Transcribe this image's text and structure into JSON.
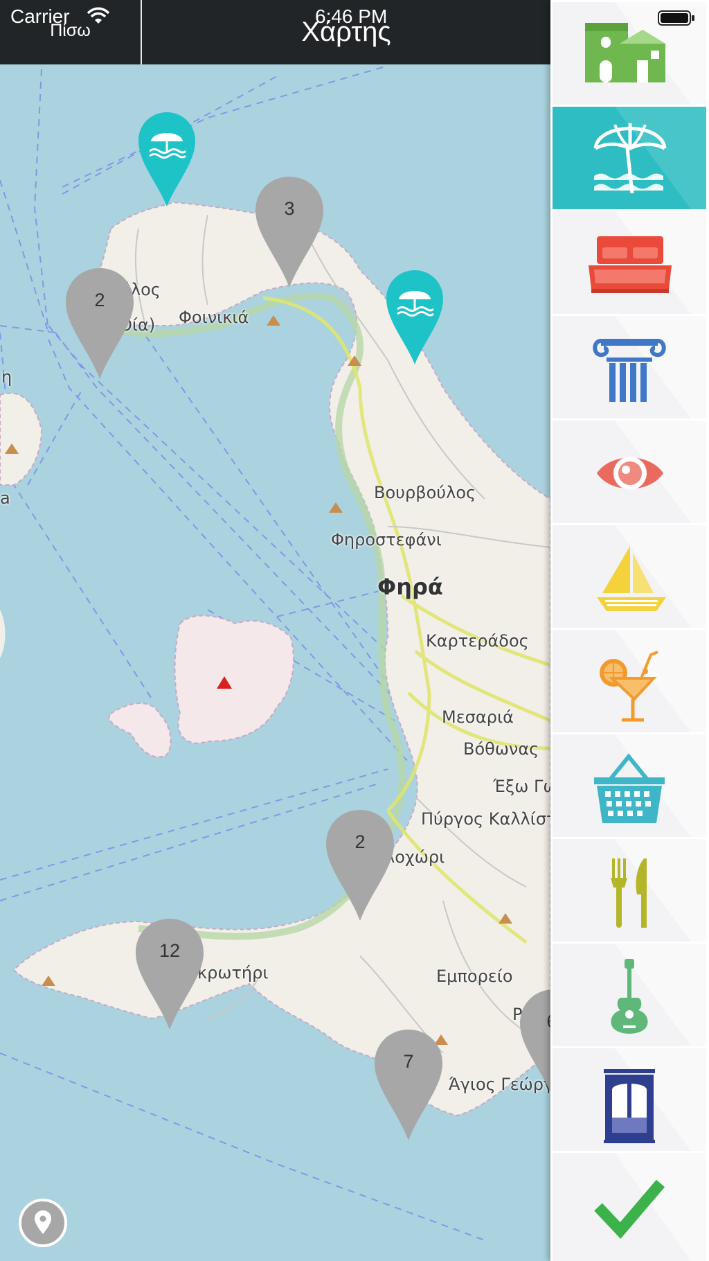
{
  "status_bar": {
    "carrier": "Carrier",
    "time": "6:46 PM"
  },
  "nav": {
    "back_label": "Πίσω",
    "title": "Χάρτης"
  },
  "map": {
    "place_labels": {
      "oia_partial_1": "ύλος",
      "oia_partial_2": "Οία)",
      "foinikia": "Φοινικιά",
      "vourvoulos": "Βουρβούλος",
      "firostefani": "Φηροστεφάνι",
      "fira": "Φηρά",
      "karterados": "Καρτεράδος",
      "mesaria": "Μεσαριά",
      "vothonas": "Βόθωνας",
      "exo_gonia": "Έξω Γω",
      "pyrgos": "Πύργος Καλλίστ",
      "megalochori": "λοχώρι",
      "akrotiri": "κρωτήρι",
      "emporeio": "Εμπορείο",
      "perissa_partial": "Ρ",
      "agios_georgios": "Άγιος Γεώργ",
      "left_partial_1": "η",
      "left_partial_2": "a"
    },
    "cluster_pins": [
      {
        "count": "3"
      },
      {
        "count": "2"
      },
      {
        "count": "2"
      },
      {
        "count": "12"
      },
      {
        "count": "7"
      },
      {
        "count": "6"
      }
    ],
    "beach_pins": [
      {
        "icon": "beach-umbrella-icon"
      },
      {
        "icon": "beach-umbrella-icon"
      }
    ],
    "locate_button_icon": "map-pin-icon"
  },
  "categories": [
    {
      "name": "accommodation",
      "icon": "houses-icon",
      "selected": false
    },
    {
      "name": "beaches",
      "icon": "beach-umbrella-icon",
      "selected": true
    },
    {
      "name": "hotels",
      "icon": "bed-icon",
      "selected": false
    },
    {
      "name": "monuments",
      "icon": "ionic-column-icon",
      "selected": false
    },
    {
      "name": "sights",
      "icon": "eye-icon",
      "selected": false
    },
    {
      "name": "sailing",
      "icon": "sailboat-icon",
      "selected": false
    },
    {
      "name": "bars",
      "icon": "cocktail-icon",
      "selected": false
    },
    {
      "name": "shopping",
      "icon": "shopping-basket-icon",
      "selected": false
    },
    {
      "name": "restaurants",
      "icon": "fork-knife-icon",
      "selected": false
    },
    {
      "name": "music",
      "icon": "guitar-icon",
      "selected": false
    },
    {
      "name": "transport",
      "icon": "cable-car-icon",
      "selected": false
    },
    {
      "name": "confirm",
      "icon": "checkmark-icon",
      "selected": false
    }
  ],
  "colors": {
    "sea": "#aad3df",
    "land": "#f2efe9",
    "nav_bar": "#222527",
    "cluster_pin": "#a7a7a7",
    "beach_pin": "#1ec3c8",
    "selected_category": "#2ebdc2"
  }
}
